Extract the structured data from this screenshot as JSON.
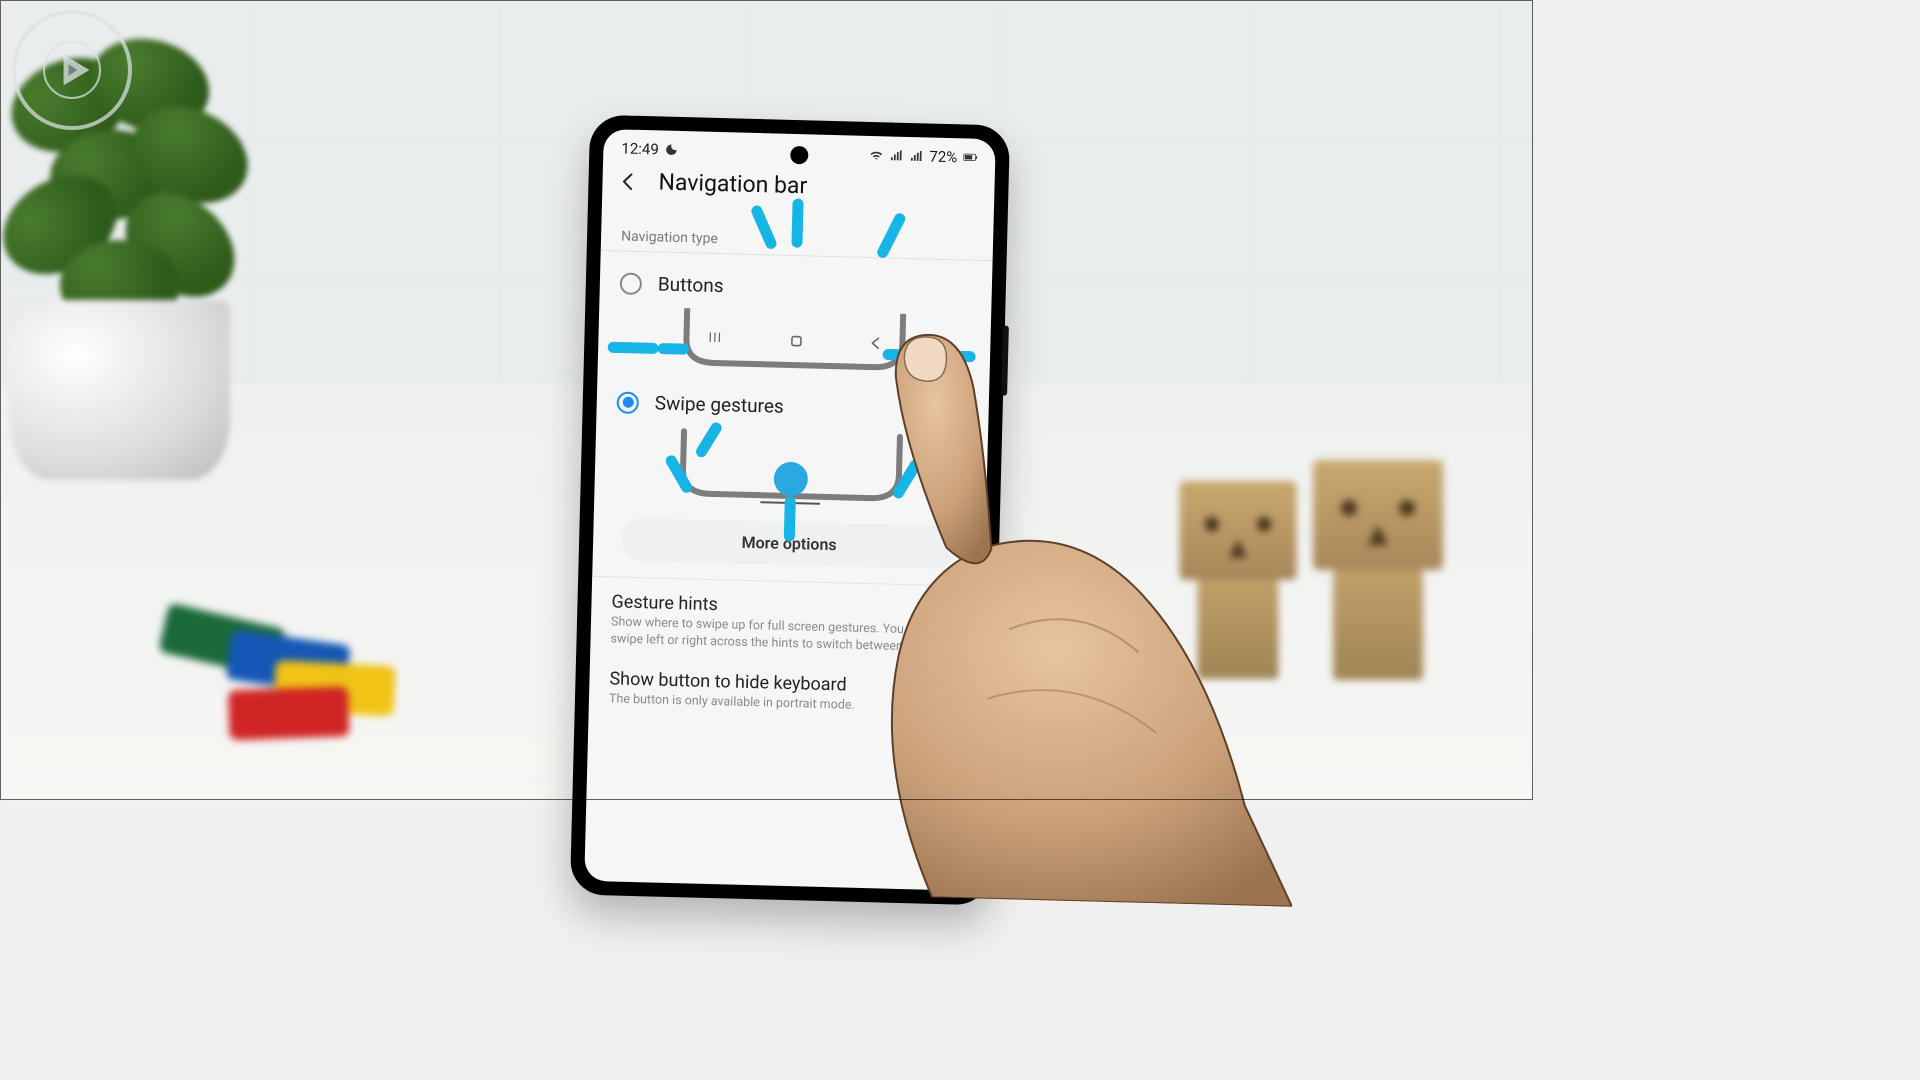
{
  "statusbar": {
    "time": "12:49",
    "battery": "72%"
  },
  "header": {
    "title": "Navigation bar"
  },
  "section": {
    "label": "Navigation type"
  },
  "options": {
    "buttons": {
      "label": "Buttons",
      "selected": false
    },
    "gestures": {
      "label": "Swipe gestures",
      "selected": true
    }
  },
  "buttons_preview": {
    "recents": "|||",
    "home": "◻",
    "back": "‹"
  },
  "more_options": "More options",
  "settings": {
    "gesture_hints": {
      "title": "Gesture hints",
      "desc": "Show where to swipe up for full screen gestures. You can also swipe left or right across the hints to switch between apps."
    },
    "hide_keyboard": {
      "title": "Show button to hide keyboard",
      "desc": "The button is only available in portrait mode."
    }
  }
}
